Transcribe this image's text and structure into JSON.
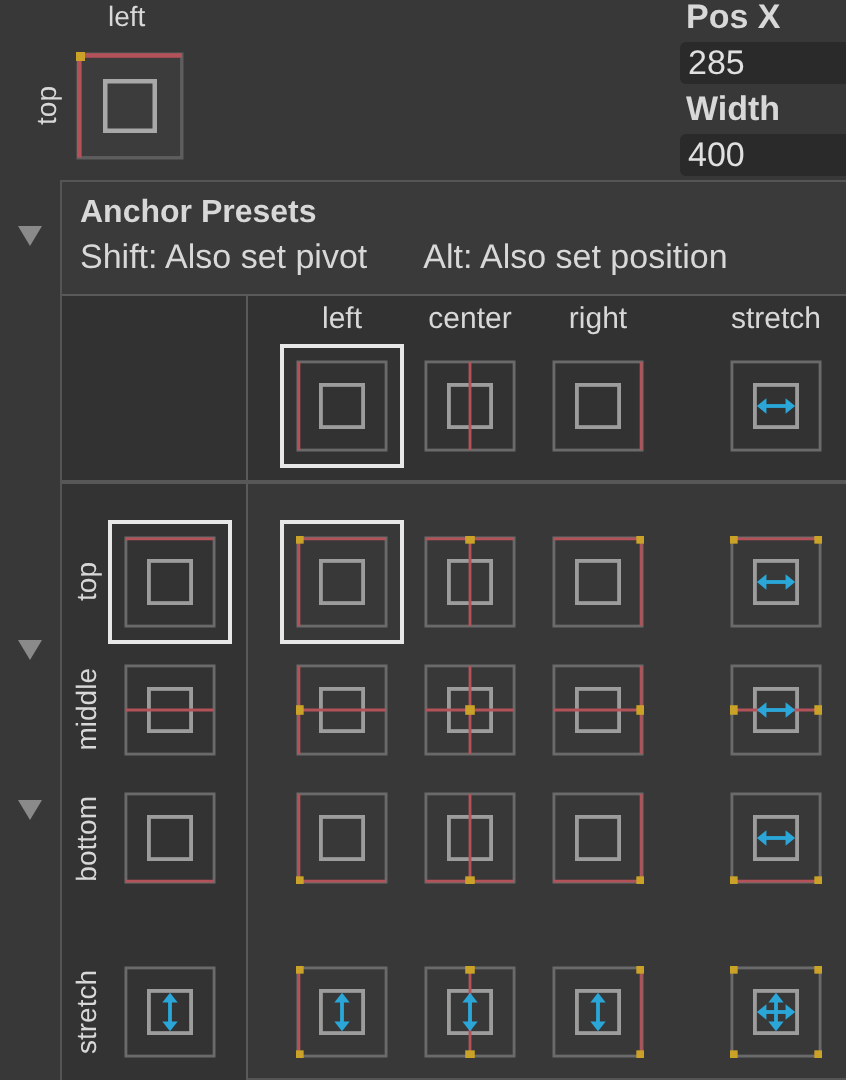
{
  "anchor_field": {
    "h_label": "left",
    "v_label": "top",
    "kind": "left-top"
  },
  "fields": [
    {
      "label": "Pos X",
      "value": "285"
    },
    {
      "label": "Width",
      "value": "400"
    }
  ],
  "foldouts": [
    {
      "expanded": true
    },
    {
      "expanded": true
    },
    {
      "expanded": true
    }
  ],
  "popup": {
    "title": "Anchor Presets",
    "hints": [
      "Shift: Also set pivot",
      "Alt: Also set position"
    ],
    "columns": [
      {
        "label": "left",
        "kind": "left",
        "selected": true
      },
      {
        "label": "center",
        "kind": "center",
        "selected": false
      },
      {
        "label": "right",
        "kind": "right",
        "selected": false
      },
      {
        "label": "stretch",
        "kind": "stretch",
        "selected": false
      }
    ],
    "rows": [
      {
        "label": "top",
        "kind": "top",
        "selected": true,
        "cells": [
          {
            "selected": true
          },
          {
            "selected": false
          },
          {
            "selected": false
          },
          {
            "selected": false
          }
        ]
      },
      {
        "label": "middle",
        "kind": "middle",
        "selected": false,
        "cells": [
          {
            "selected": false
          },
          {
            "selected": false
          },
          {
            "selected": false
          },
          {
            "selected": false
          }
        ]
      },
      {
        "label": "bottom",
        "kind": "bottom",
        "selected": false,
        "cells": [
          {
            "selected": false
          },
          {
            "selected": false
          },
          {
            "selected": false
          },
          {
            "selected": false
          }
        ]
      },
      {
        "label": "stretch",
        "kind": "stretch",
        "selected": false,
        "cells": [
          {
            "selected": false
          },
          {
            "selected": false
          },
          {
            "selected": false
          },
          {
            "selected": false
          }
        ]
      }
    ]
  }
}
